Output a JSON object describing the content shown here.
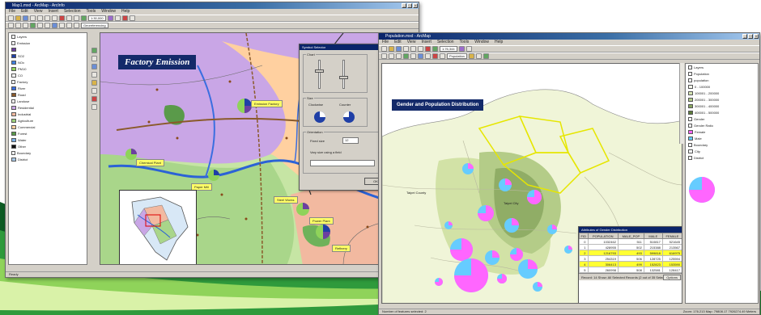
{
  "background": {
    "swoosh_colors": [
      "#0d5a23",
      "#2f9a3c",
      "#8fd35a",
      "#d9f2a8"
    ]
  },
  "factory_window": {
    "title": "Map1.mxd - ArcMap - ArcInfo",
    "menus": [
      "File",
      "Edit",
      "View",
      "Insert",
      "Selection",
      "Tools",
      "Window",
      "Help"
    ],
    "scale_value": "1:30,000",
    "editor_label": "Georeferencing",
    "map_title": "Factory Emission",
    "toc": {
      "items": [
        {
          "label": "Layers",
          "color": ""
        },
        {
          "label": "Emission",
          "color": ""
        },
        {
          "label": "",
          "color": "#6b3fa0"
        },
        {
          "label": "SO2",
          "color": "#1f3fa6"
        },
        {
          "label": "NOx",
          "color": "#3f7fe0"
        },
        {
          "label": "PM10",
          "color": "#8fd35a"
        },
        {
          "label": "CO",
          "color": "#ffffff"
        },
        {
          "label": "Factory",
          "color": ""
        },
        {
          "label": "River",
          "color": "#3a6ee0"
        },
        {
          "label": "Road",
          "color": "#8a5a2a"
        },
        {
          "label": "Landuse",
          "color": ""
        },
        {
          "label": "Residential",
          "color": "#c9a6e6"
        },
        {
          "label": "Industrial",
          "color": "#f2b9a0"
        },
        {
          "label": "Agriculture",
          "color": "#9ccf7a"
        },
        {
          "label": "Commercial",
          "color": "#ffd0a0"
        },
        {
          "label": "Forest",
          "color": "#5a9a4a"
        },
        {
          "label": "Water",
          "color": "#77aee6"
        },
        {
          "label": "Other",
          "color": "#111111"
        },
        {
          "label": "Boundary",
          "color": ""
        },
        {
          "label": "District",
          "color": "#a8c8e8"
        }
      ]
    },
    "callouts": [
      "Emission Factory",
      "Chemical Plant",
      "Paper Mill",
      "Steel Works",
      "Power Plant",
      "Refinery"
    ],
    "dialog": {
      "title": "Symbol Selector",
      "group1_label": "Chart",
      "group2_label": "Size",
      "group3_label": "Orientation",
      "radio1": "Clockwise",
      "radio2": "Counter",
      "fixed_label": "Fixed size",
      "vary_label": "Vary size using a field",
      "size_value": "12",
      "ok_label": "OK",
      "cancel_label": "Cancel"
    },
    "status_left": "Ready",
    "status_right": "Drawing Map..."
  },
  "population_window": {
    "title": "Population.mxd - ArcMap",
    "menus": [
      "File",
      "Edit",
      "View",
      "Insert",
      "Selection",
      "Tools",
      "Window",
      "Help"
    ],
    "scale_value": "1:76,344",
    "layer_select": "Population",
    "map_title": "Gender and Population Distribution",
    "place_labels": [
      "Taipei City",
      "Taipei County"
    ],
    "toc": {
      "items": [
        {
          "label": "Layers",
          "color": ""
        },
        {
          "label": "Population",
          "color": ""
        },
        {
          "label": "population",
          "color": ""
        },
        {
          "label": "0 - 100000",
          "color": "#f4f7ea"
        },
        {
          "label": "100001 - 200000",
          "color": "#d7e6b4"
        },
        {
          "label": "200001 - 300000",
          "color": "#b3cc8a"
        },
        {
          "label": "300001 - 400000",
          "color": "#8aa860"
        },
        {
          "label": "400001 - 500000",
          "color": "#5e7d3c"
        },
        {
          "label": "Gender",
          "color": ""
        },
        {
          "label": "Gender Ratio",
          "color": ""
        },
        {
          "label": "Female",
          "color": "#ff66ff"
        },
        {
          "label": "Male",
          "color": "#66ccff"
        },
        {
          "label": "Boundary",
          "color": ""
        },
        {
          "label": "City",
          "color": "#ffffff"
        },
        {
          "label": "District",
          "color": ""
        }
      ]
    },
    "table": {
      "title": "Attributes of Gender Distribution",
      "columns": [
        "FID",
        "POPULATION",
        "MALE_POP",
        "MALE",
        "FEMALE"
      ],
      "rows": [
        [
          "0",
          "1032462",
          "511",
          "510817",
          "521645"
        ],
        [
          "1",
          "428955",
          "502",
          "215388",
          "213567"
        ],
        [
          "2",
          "1216793",
          "493",
          "599818",
          "616975"
        ],
        [
          "3",
          "254319",
          "506",
          "128725",
          "125594"
        ],
        [
          "4",
          "306413",
          "499",
          "152823",
          "153590"
        ],
        [
          "5",
          "260998",
          "508",
          "132581",
          "128417"
        ]
      ],
      "selected_rows": [
        2,
        4
      ],
      "footer": "Record: 14  Show: All  Selected  Records (2 out of 35 Selected)",
      "options_label": "Options"
    },
    "status_left": "Number of features selected: 2",
    "status_right": "Zoom: 176.213  Map: 79808.17  7926274.49 Meters"
  }
}
